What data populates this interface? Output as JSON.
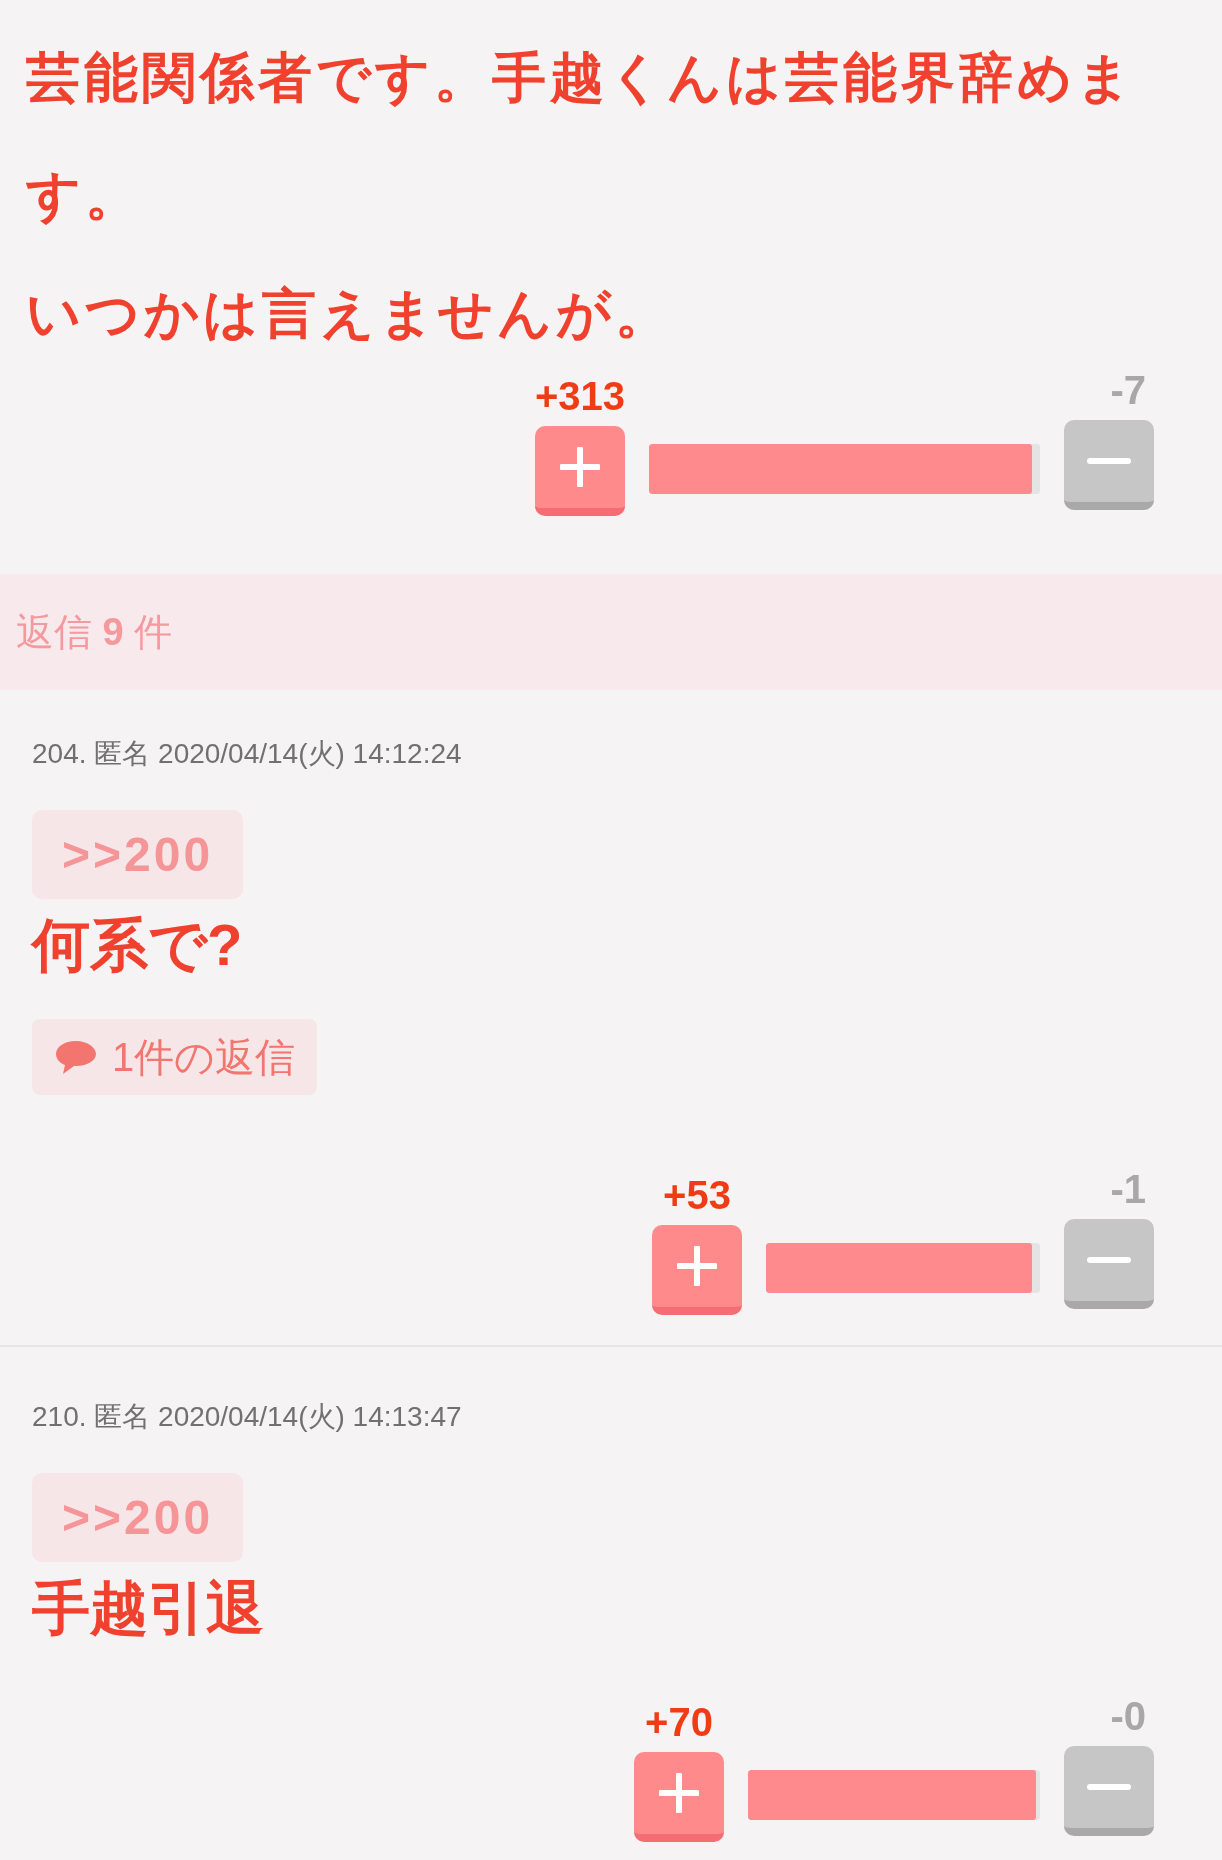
{
  "post": {
    "paragraphs": [
      "芸能関係者です。手越くんは芸能界辞めます。",
      "いつかは言えませんが。"
    ],
    "votes": {
      "plus": "+313",
      "minus": "-7",
      "level": 0.98
    }
  },
  "replies_header": "返信 **9** 件",
  "replies": [
    {
      "meta": "204. 匿名 2020/04/14(火) 14:12:24",
      "anchor": ">>200",
      "text": "何系で?",
      "reply_link": "1件の返信",
      "votes": {
        "plus": "+53",
        "minus": "-1",
        "level": 0.97
      }
    },
    {
      "meta": "210. 匿名 2020/04/14(火) 14:13:47",
      "anchor": ">>200",
      "text": "手越引退",
      "votes": {
        "plus": "+70",
        "minus": "-0",
        "level": 0.985
      }
    }
  ]
}
